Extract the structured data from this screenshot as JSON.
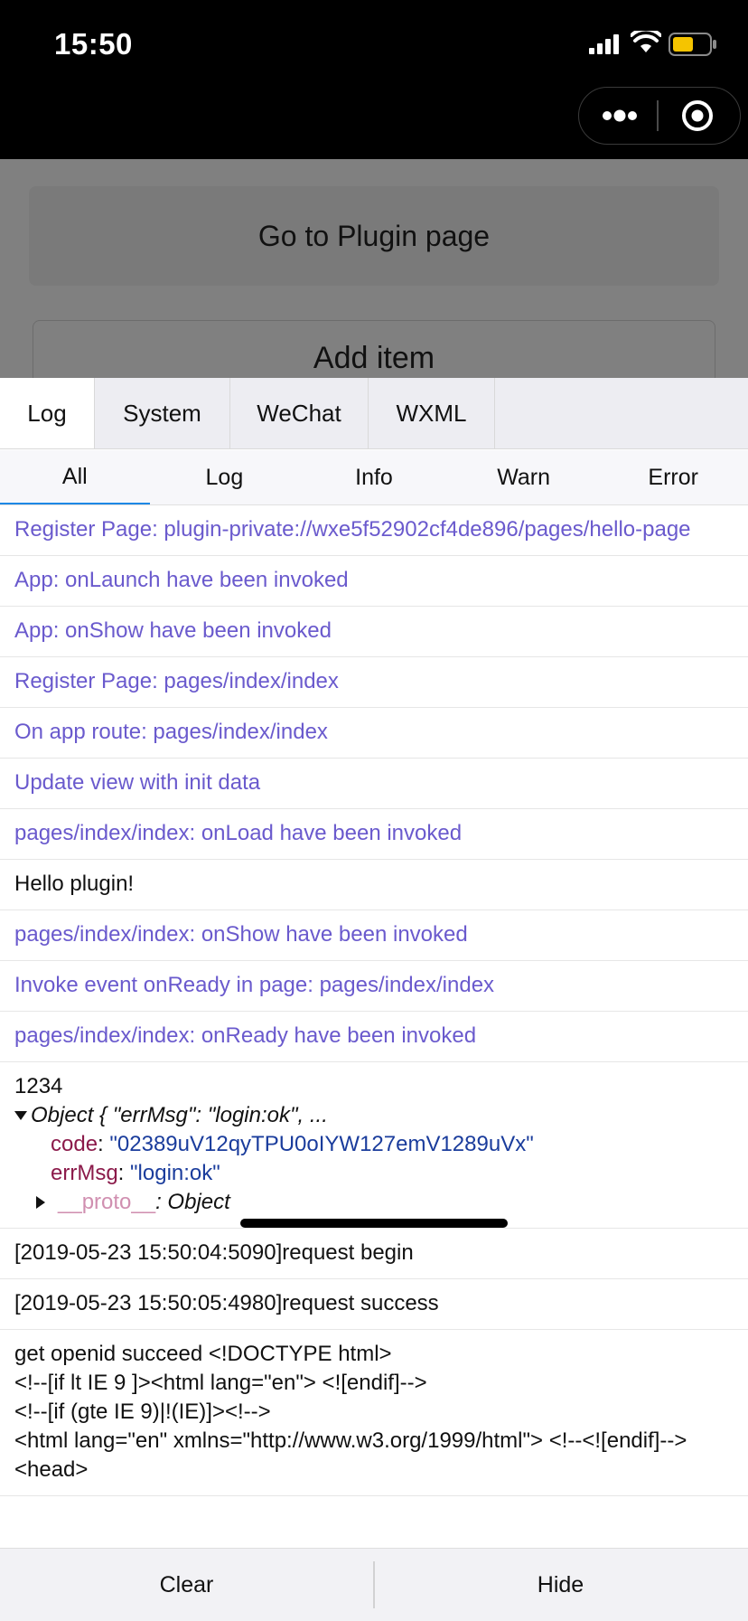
{
  "status": {
    "time": "15:50"
  },
  "page": {
    "plugin_button": "Go to Plugin page",
    "add_button": "Add item"
  },
  "console": {
    "tabs": [
      "Log",
      "System",
      "WeChat",
      "WXML"
    ],
    "subtabs": [
      "All",
      "Log",
      "Info",
      "Warn",
      "Error"
    ],
    "logs": {
      "l0": "Register Page: plugin-private://wxe5f52902cf4de896/pages/hello-page",
      "l1": "App: onLaunch have been invoked",
      "l2": "App: onShow have been invoked",
      "l3": "Register Page: pages/index/index",
      "l4": "On app route: pages/index/index",
      "l5": "Update view with init data",
      "l6": "pages/index/index: onLoad have been invoked",
      "l7": "Hello plugin!",
      "l8": "pages/index/index: onShow have been invoked",
      "l9": "Invoke event onReady in page: pages/index/index",
      "l10": "pages/index/index: onReady have been invoked",
      "obj": {
        "prefix": "1234",
        "summary": "Object { \"errMsg\": \"login:ok\", ...",
        "code_key": "code",
        "code_val": "\"02389uV12qyTPU0oIYW127emV1289uVx\"",
        "errmsg_key": "errMsg",
        "errmsg_val": "\"login:ok\"",
        "proto_key": "__proto__",
        "proto_val": ": Object"
      },
      "l11": "[2019-05-23 15:50:04:5090]request begin",
      "l12": "[2019-05-23 15:50:05:4980]request success",
      "l13a": "get openid succeed <!DOCTYPE html>",
      "l13b": "<!--[if lt IE 9 ]><html lang=\"en\"> <![endif]-->",
      "l13c": "<!--[if (gte IE 9)|!(IE)]><!-->",
      "l13d": "<html lang=\"en\" xmlns=\"http://www.w3.org/1999/html\"> <!--<![endif]-->",
      "l13e": "<head>"
    },
    "clear_label": "Clear",
    "hide_label": "Hide"
  },
  "colors": {
    "system_log": "#6a5acd",
    "active_subtab": "#1e88e5"
  }
}
